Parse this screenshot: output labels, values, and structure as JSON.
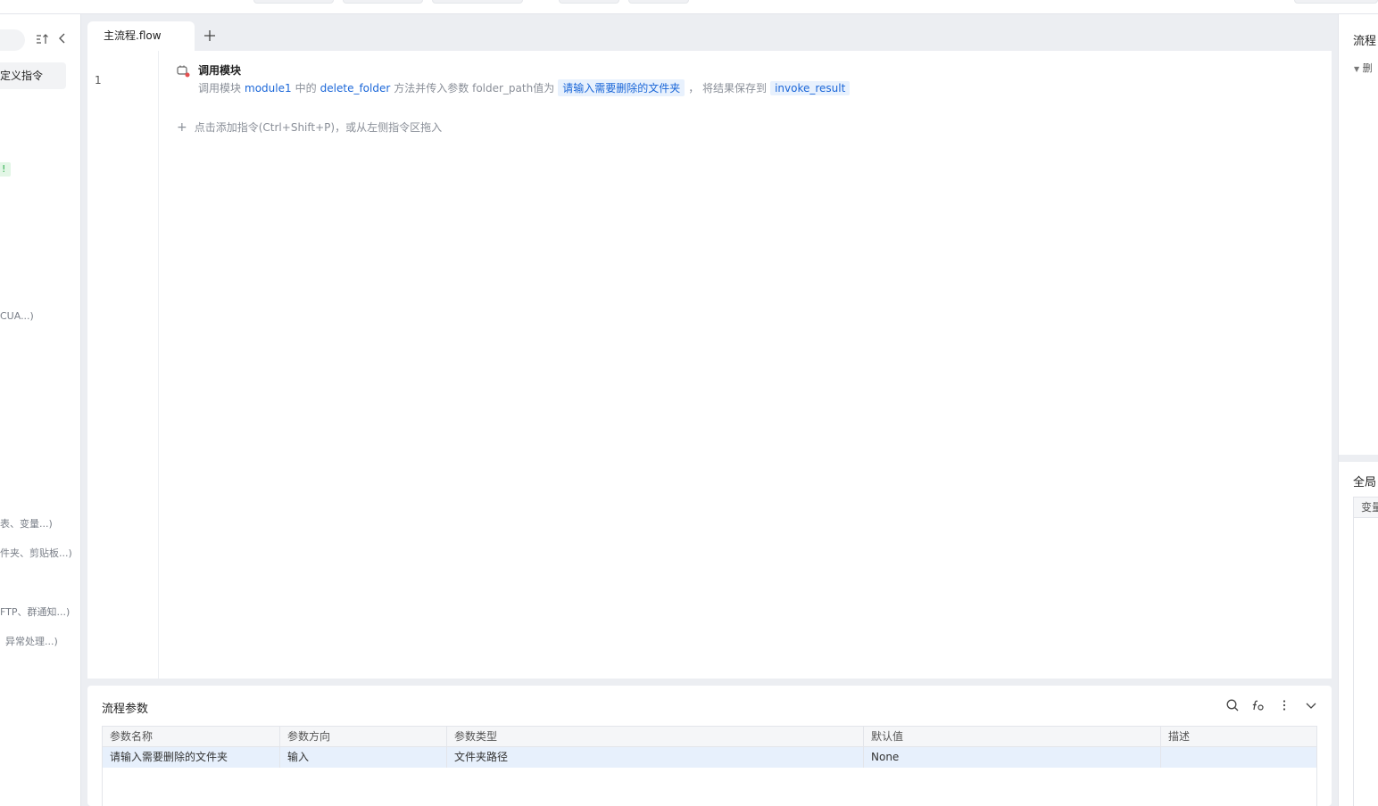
{
  "left_panel": {
    "custom_command_label": "定义指令",
    "badge": "!",
    "items": [
      "CUA...)",
      "表、变量...)",
      "件夹、剪贴板...)",
      "FTP、群通知...)",
      "异常处理...)"
    ]
  },
  "editor": {
    "tab_label": "主流程.flow",
    "line_number": "1",
    "command": {
      "title": "调用模块",
      "desc_prefix": "调用模块",
      "module": "module1",
      "in_text": "中的",
      "method": "delete_folder",
      "pass_text": "方法并传入参数 folder_path值为",
      "param_value": "请输入需要删除的文件夹",
      "save_text": "， 将结果保存到",
      "result_var": "invoke_result"
    },
    "add_command_hint": "点击添加指令(Ctrl+Shift+P)，或从左侧指令区拖入"
  },
  "params": {
    "title": "流程参数",
    "columns": [
      "参数名称",
      "参数方向",
      "参数类型",
      "默认值",
      "描述"
    ],
    "rows": [
      [
        "请输入需要删除的文件夹",
        "输入",
        "文件夹路径",
        "None",
        ""
      ]
    ]
  },
  "right_panel": {
    "title": "流程",
    "tree_item": "删",
    "global_title": "全局",
    "global_col": "变量"
  }
}
